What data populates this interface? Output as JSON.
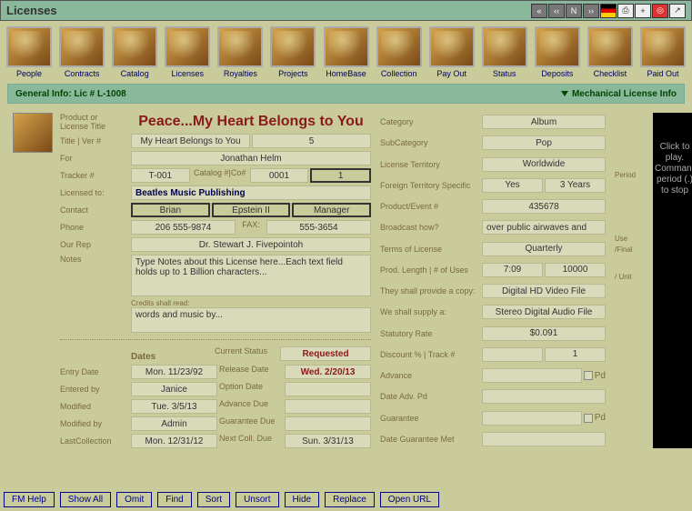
{
  "window_title": "Licenses",
  "nav": [
    "People",
    "Contracts",
    "Catalog",
    "Licenses",
    "Royalties",
    "Projects",
    "HomeBase",
    "Collection",
    "Pay Out",
    "Status",
    "Deposits",
    "Checklist",
    "Paid Out"
  ],
  "section": {
    "left": "General Info: Lic # L-1008",
    "right": "Mechanical License Info"
  },
  "title_main": "Peace...My Heart Belongs to You",
  "left": {
    "product_label": "Product or License Title",
    "title_ver": "Title | Ver #",
    "title_val": "My Heart Belongs to You",
    "ver_val": "5",
    "for": "For",
    "for_val": "Jonathan Helm",
    "tracker": "Tracker #",
    "tracker_val": "T-001",
    "catalog_lbl": "Catalog #|Co#",
    "catalog_val": "0001",
    "co_val": "1",
    "licensed_to": "Licensed to:",
    "licensed_val": "Beatles Music Publishing",
    "contact": "Contact",
    "contact_first": "Brian",
    "contact_last": "Epstein II",
    "contact_role": "Manager",
    "phone": "Phone",
    "phone_val": "206 555-9874",
    "fax": "FAX:",
    "fax_val": "555-3654",
    "our_rep": "Our Rep",
    "our_rep_val": "Dr. Stewart J. Fivepointoh",
    "notes": "Notes",
    "notes_val": "Type Notes about this License here...Each text field holds up to 1 Billion characters...",
    "credits_lbl": "Credits shall read:",
    "credits_val": "words and music by...",
    "dates_hdr": "Dates",
    "curr_status_lbl": "Current Status",
    "curr_status": "Requested",
    "entry_date": "Entry Date",
    "entry_date_val": "Mon. 11/23/92",
    "release": "Release Date",
    "release_val": "Wed. 2/20/13",
    "entered_by": "Entered by",
    "entered_by_val": "Janice",
    "option": "Option Date",
    "modified": "Modified",
    "modified_val": "Tue. 3/5/13",
    "adv_due": "Advance Due",
    "modified_by": "Modified by",
    "modified_by_val": "Admin",
    "guar_due": "Guarantee Due",
    "last_coll": "LastCollection",
    "last_coll_val": "Mon. 12/31/12",
    "next_coll": "Next Coll. Due",
    "next_coll_val": "Sun. 3/31/13"
  },
  "right": {
    "category": "Category",
    "category_val": "Album",
    "subcat": "SubCategory",
    "subcat_val": "Pop",
    "territory": "License Territory",
    "territory_val": "Worldwide",
    "foreign": "Foreign Territory Specific",
    "foreign_yes": "Yes",
    "foreign_years": "3 Years",
    "period": "Period",
    "product_evt": "Product/Event #",
    "product_evt_val": "435678",
    "broadcast": "Broadcast how?",
    "broadcast_val": "over public airwaves and",
    "terms": "Terms of License",
    "terms_val": "Quarterly",
    "prod_len": "Prod. Length | # of Uses",
    "prod_len_val": "7:09",
    "uses_val": "10000",
    "use": "Use",
    "they_provide": "They shall provide a copy:",
    "they_provide_val": "Digital HD Video File",
    "final": "/Final",
    "we_supply": "We shall supply a:",
    "we_supply_val": "Stereo Digital Audio File",
    "stat_rate": "Statutory Rate",
    "stat_rate_val": "$0.091",
    "unit": "/ Unit",
    "disc_track": "Discount % | Track #",
    "track_val": "1",
    "advance": "Advance",
    "date_adv": "Date Adv. Pd",
    "guarantee": "Guarantee",
    "date_guar": "Date Guarantee Met",
    "pd": "Pd"
  },
  "play": {
    "click": "Click to play. Command period (.) to stop"
  },
  "footer": [
    "FM Help",
    "Show All",
    "Omit",
    "Find",
    "Sort",
    "Unsort",
    "Hide",
    "Replace",
    "Open URL"
  ]
}
